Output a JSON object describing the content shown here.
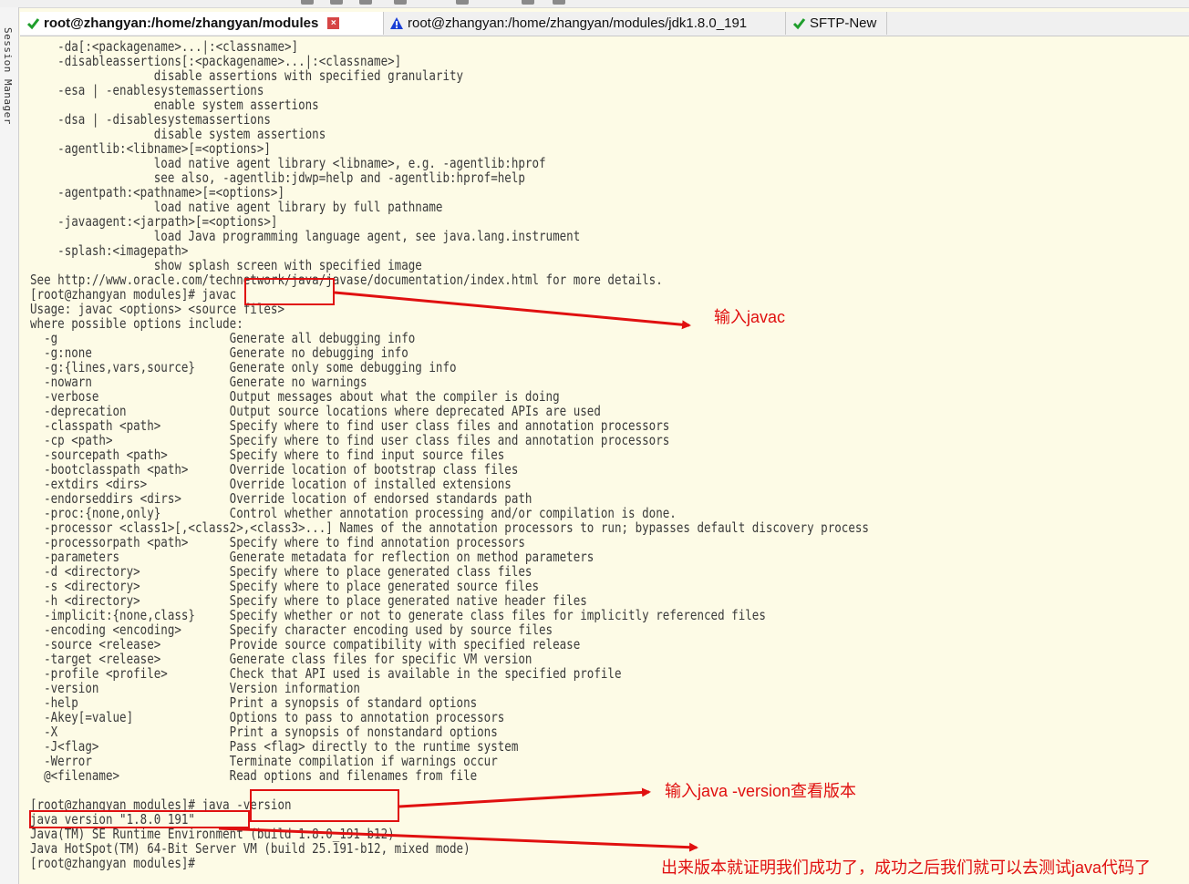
{
  "sidebar": {
    "label": "Session Manager"
  },
  "tabs": [
    {
      "label": "root@zhangyan:/home/zhangyan/modules",
      "status_icon": "check-icon",
      "active": true
    },
    {
      "label": "root@zhangyan:/home/zhangyan/modules/jdk1.8.0_191",
      "status_icon": "warning-icon",
      "active": false
    },
    {
      "label": "SFTP-New",
      "status_icon": "check-icon",
      "active": false
    }
  ],
  "terminal": {
    "lines": [
      "    -da[:<packagename>...|:<classname>]",
      "    -disableassertions[:<packagename>...|:<classname>]",
      "                  disable assertions with specified granularity",
      "    -esa | -enablesystemassertions",
      "                  enable system assertions",
      "    -dsa | -disablesystemassertions",
      "                  disable system assertions",
      "    -agentlib:<libname>[=<options>]",
      "                  load native agent library <libname>, e.g. -agentlib:hprof",
      "                  see also, -agentlib:jdwp=help and -agentlib:hprof=help",
      "    -agentpath:<pathname>[=<options>]",
      "                  load native agent library by full pathname",
      "    -javaagent:<jarpath>[=<options>]",
      "                  load Java programming language agent, see java.lang.instrument",
      "    -splash:<imagepath>",
      "                  show splash screen with specified image",
      "See http://www.oracle.com/technetwork/java/javase/documentation/index.html for more details.",
      "[root@zhangyan modules]# javac",
      "Usage: javac <options> <source files>",
      "where possible options include:",
      "  -g                         Generate all debugging info",
      "  -g:none                    Generate no debugging info",
      "  -g:{lines,vars,source}     Generate only some debugging info",
      "  -nowarn                    Generate no warnings",
      "  -verbose                   Output messages about what the compiler is doing",
      "  -deprecation               Output source locations where deprecated APIs are used",
      "  -classpath <path>          Specify where to find user class files and annotation processors",
      "  -cp <path>                 Specify where to find user class files and annotation processors",
      "  -sourcepath <path>         Specify where to find input source files",
      "  -bootclasspath <path>      Override location of bootstrap class files",
      "  -extdirs <dirs>            Override location of installed extensions",
      "  -endorseddirs <dirs>       Override location of endorsed standards path",
      "  -proc:{none,only}          Control whether annotation processing and/or compilation is done.",
      "  -processor <class1>[,<class2>,<class3>...] Names of the annotation processors to run; bypasses default discovery process",
      "  -processorpath <path>      Specify where to find annotation processors",
      "  -parameters                Generate metadata for reflection on method parameters",
      "  -d <directory>             Specify where to place generated class files",
      "  -s <directory>             Specify where to place generated source files",
      "  -h <directory>             Specify where to place generated native header files",
      "  -implicit:{none,class}     Specify whether or not to generate class files for implicitly referenced files",
      "  -encoding <encoding>       Specify character encoding used by source files",
      "  -source <release>          Provide source compatibility with specified release",
      "  -target <release>          Generate class files for specific VM version",
      "  -profile <profile>         Check that API used is available in the specified profile",
      "  -version                   Version information",
      "  -help                      Print a synopsis of standard options",
      "  -Akey[=value]              Options to pass to annotation processors",
      "  -X                         Print a synopsis of nonstandard options",
      "  -J<flag>                   Pass <flag> directly to the runtime system",
      "  -Werror                    Terminate compilation if warnings occur",
      "  @<filename>                Read options and filenames from file",
      "",
      "[root@zhangyan modules]# java -version",
      "java version \"1.8.0_191\"",
      "Java(TM) SE Runtime Environment (build 1.8.0_191-b12)",
      "Java HotSpot(TM) 64-Bit Server VM (build 25.191-b12, mixed mode)",
      "[root@zhangyan modules]#"
    ]
  },
  "annotations": {
    "javac_note": "输入javac",
    "version_note": "输入java -version查看版本",
    "success_note": "出来版本就证明我们成功了，成功之后我们就可以去测试java代码了",
    "color": "#e01010"
  },
  "colors": {
    "terminal_bg": "#fdfbe6",
    "terminal_text": "#3a3a3a"
  }
}
